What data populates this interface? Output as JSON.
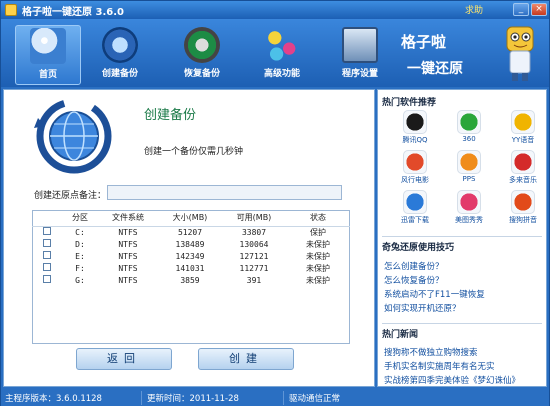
{
  "window": {
    "title": "格子啦一键还原 3.6.0",
    "help": "求助",
    "min": "_",
    "close": "×"
  },
  "nav": [
    {
      "label": "首页",
      "icon": "home-icon"
    },
    {
      "label": "创建备份",
      "icon": "create-backup-icon"
    },
    {
      "label": "恢复备份",
      "icon": "restore-backup-icon"
    },
    {
      "label": "高级功能",
      "icon": "advanced-icon"
    },
    {
      "label": "程序设置",
      "icon": "settings-icon"
    }
  ],
  "brand": {
    "line1": "格子啦",
    "line2": "一键还原"
  },
  "main": {
    "title": "创建备份",
    "subtitle": "创建一个备份仅需几秒钟",
    "note_label": "创建还原点备注：",
    "note_value": "",
    "columns": [
      "分区",
      "文件系统",
      "大小(MB)",
      "可用(MB)",
      "状态"
    ],
    "rows": [
      {
        "part": "C:",
        "fs": "NTFS",
        "size": "51207",
        "free": "33807",
        "status": "保护"
      },
      {
        "part": "D:",
        "fs": "NTFS",
        "size": "138489",
        "free": "130064",
        "status": "未保护"
      },
      {
        "part": "E:",
        "fs": "NTFS",
        "size": "142349",
        "free": "127121",
        "status": "未保护"
      },
      {
        "part": "F:",
        "fs": "NTFS",
        "size": "141031",
        "free": "112771",
        "status": "未保护"
      },
      {
        "part": "G:",
        "fs": "NTFS",
        "size": "3859",
        "free": "391",
        "status": "未保护"
      }
    ],
    "back_button": "返回",
    "create_button": "创建"
  },
  "side": {
    "hot_title": "热门软件推荐",
    "apps": [
      {
        "label": "腾讯QQ",
        "color": "#1a1a1a"
      },
      {
        "label": "360",
        "color": "#2aa63a"
      },
      {
        "label": "YY语音",
        "color": "#f0b400"
      },
      {
        "label": "风行电影",
        "color": "#e24a2a"
      },
      {
        "label": "PPS",
        "color": "#f08c1a"
      },
      {
        "label": "多来音乐",
        "color": "#d42a2a"
      },
      {
        "label": "迅雷下载",
        "color": "#2a7ad8"
      },
      {
        "label": "美图秀秀",
        "color": "#e23a6a"
      },
      {
        "label": "搜狗拼音",
        "color": "#e24a1a"
      }
    ],
    "tips_title": "奇兔还原使用技巧",
    "tips": [
      "怎么创建备份？",
      "怎么恢复备份？",
      "系统启动不了F11一键恢复",
      "如何实现开机还原？"
    ],
    "news_title": "热门新闻",
    "news": [
      "搜狗称不做独立购物搜索",
      "手机实名制实施周年有名无实",
      "实战榜第四季完美体验《梦幻诛仙》"
    ]
  },
  "status": {
    "version": "主程序版本：3.6.0.1128",
    "updated": "更新时间：2011-11-28",
    "driver": "驱动通信正常"
  }
}
